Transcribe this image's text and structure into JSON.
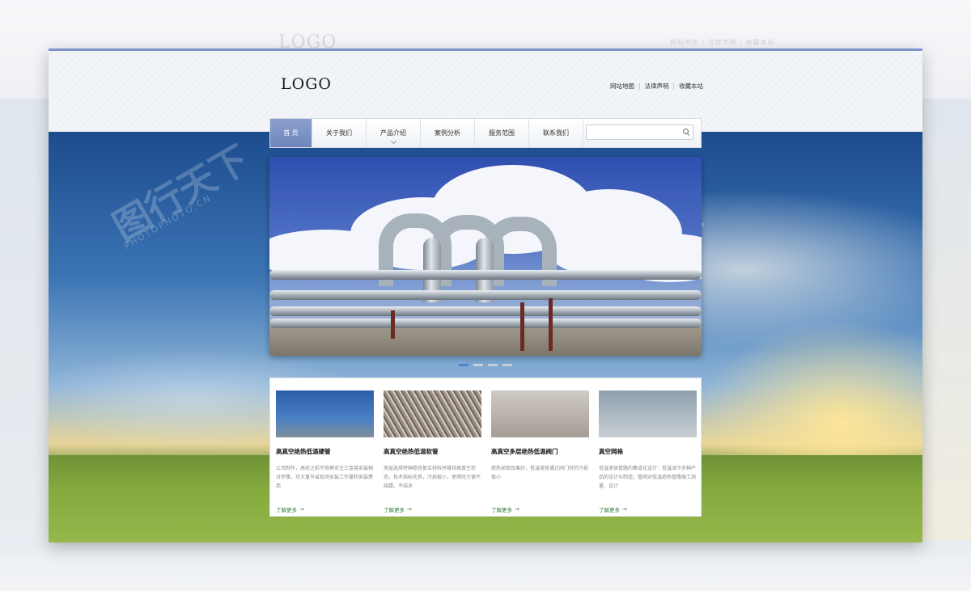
{
  "ghost": {
    "logo": "LOGO",
    "links": "网站地图 | 法律声明 | 收藏本站"
  },
  "header": {
    "logo": "LOGO",
    "links": [
      "网站地图",
      "法律声明",
      "收藏本站"
    ]
  },
  "nav": {
    "items": [
      {
        "label": "首 页",
        "active": true
      },
      {
        "label": "关于我们"
      },
      {
        "label": "产品介绍"
      },
      {
        "label": "案例分析"
      },
      {
        "label": "服务范围"
      },
      {
        "label": "联系我们"
      }
    ],
    "search_value": ""
  },
  "slider": {
    "slides": 4,
    "active": 1
  },
  "products": [
    {
      "title": "高真空绝热低温硬管",
      "desc": "公司制作，高校之前不用再安注三连接安装相对步骤，可大量节省现场安装工作量和安装费用",
      "more": "了解更多"
    },
    {
      "title": "高真空绝热低温软管",
      "desc": "夹层选用特种绝热复合材料并维持高真空状态，技术指标优良，冷损极小，使用时方便不结霜，不结冰",
      "more": "了解更多"
    },
    {
      "title": "高真空多层绝热低温阀门",
      "desc": "绝热采取效果好，低温液体通过阀门时的冷损极小",
      "more": "了解更多"
    },
    {
      "title": "真空网格",
      "desc": "低温液体管路的集成化设计：低温深冷多种产品的设计与制造；管网对低温绝热管路施工测量、设计",
      "more": "了解更多"
    }
  ],
  "watermark": {
    "text": "图行天下",
    "sub": "PHOTOPHOTO.CN"
  },
  "colors": {
    "nav_active": "#7b8fc4",
    "frame_border": "#7b93c7",
    "more_link": "#2f7d3a"
  }
}
